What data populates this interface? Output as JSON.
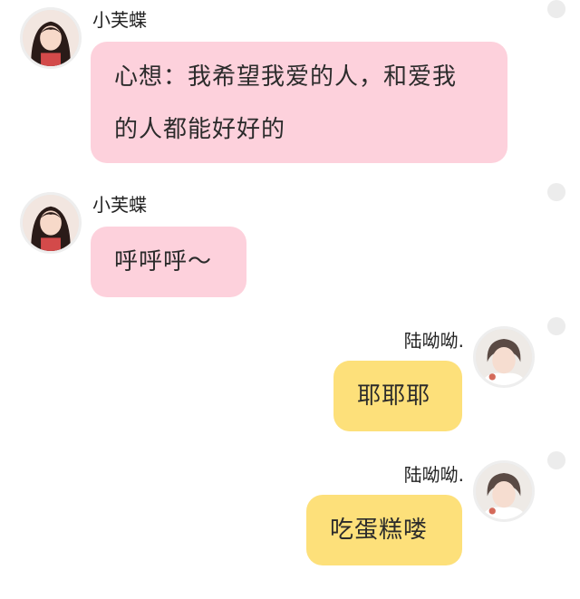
{
  "chat": {
    "messages": [
      {
        "side": "left",
        "sender": "小芙蝶",
        "avatar_icon": "avatar-girl-icon",
        "lines": [
          "心想：我希望我爱的人，和爱我",
          "的人都能好好的"
        ]
      },
      {
        "side": "left",
        "sender": "小芙蝶",
        "avatar_icon": "avatar-girl-icon",
        "lines": [
          "呼呼呼～"
        ]
      },
      {
        "side": "right",
        "sender": "陆呦呦.",
        "avatar_icon": "avatar-woman-icon",
        "lines": [
          "耶耶耶"
        ]
      },
      {
        "side": "right",
        "sender": "陆呦呦.",
        "avatar_icon": "avatar-woman-icon",
        "lines": [
          "吃蛋糕喽"
        ]
      }
    ]
  },
  "colors": {
    "left_bubble": "#fdd1dc",
    "right_bubble": "#fde07a",
    "background": "#ffffff"
  }
}
